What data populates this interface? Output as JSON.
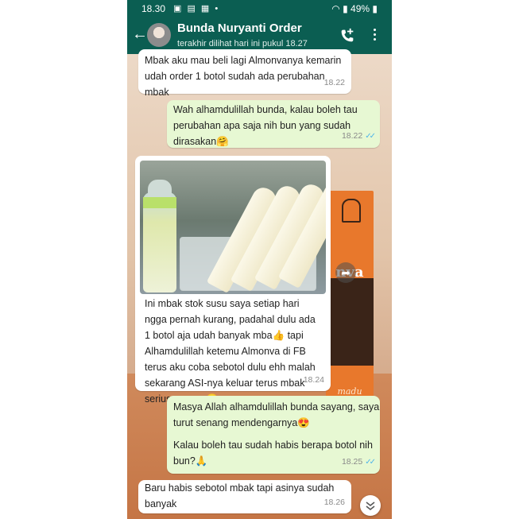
{
  "status_bar": {
    "time": "18.30",
    "battery": "49%"
  },
  "header": {
    "contact_name": "Bunda Nuryanti Order",
    "last_seen": "terakhir dilihat hari ini pukul 18.27"
  },
  "messages": [
    {
      "direction": "in",
      "text": "Mbak aku mau beli lagi Almonvanya kemarin\nudah order 1 botol sudah ada perubahan mbak",
      "time": "18.22"
    },
    {
      "direction": "out",
      "text": "Wah alhamdulillah bunda, kalau boleh tau\nperubahan apa saja nih bun yang sudah\ndirasakan🤗",
      "time": "18.22"
    },
    {
      "direction": "in",
      "has_photo": true,
      "text": "Ini mbak stok susu saya setiap hari\nngga pernah kurang, padahal dulu ada\n1 botol aja udah banyak mba👍 tapi\nAlhamdulillah ketemu Almonva di FB\nterus aku coba sebotol dulu ehh malah\nsekarang ASI-nya keluar terus mbak\nseriusan saya🤭",
      "time": "18.24"
    },
    {
      "direction": "out",
      "text": "Masya Allah alhamdulillah bunda sayang, saya\nturut senang mendengarnya😍",
      "text2": "Kalau boleh tau sudah habis berapa botol nih\nbun?🙏",
      "time": "18.25"
    },
    {
      "direction": "in",
      "text": "Baru habis sebotol mbak tapi asinya sudah\nbanyak",
      "time": "18.26"
    }
  ],
  "background_product": {
    "brand_partial": "nva",
    "tagline": "madu herbal"
  },
  "colors": {
    "header": "#0b5e52",
    "outgoing_bubble": "#e7f8d3",
    "incoming_bubble": "#ffffff",
    "read_ticks": "#4fb5ea"
  }
}
